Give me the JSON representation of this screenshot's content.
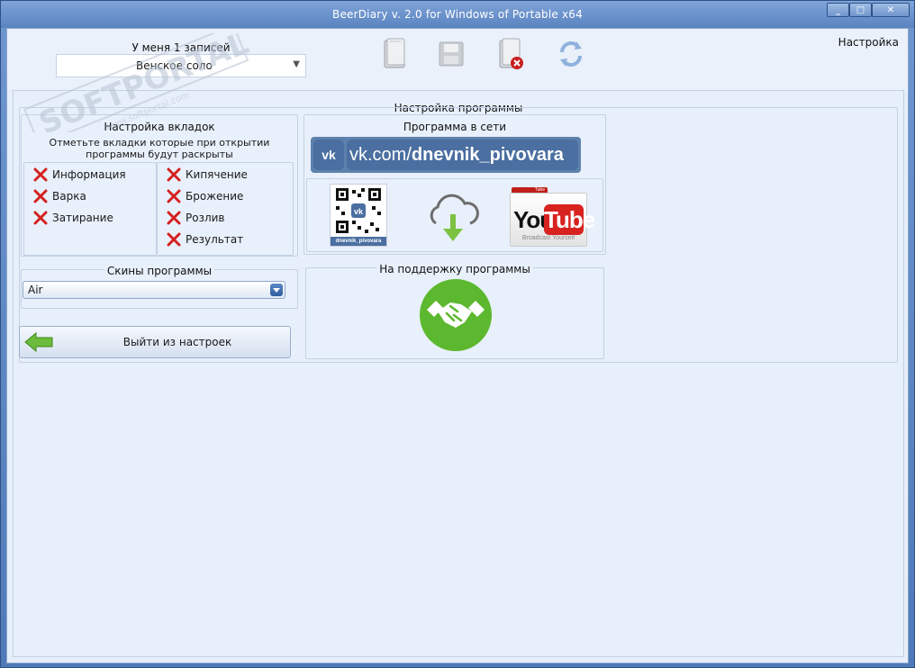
{
  "window": {
    "title": "BeerDiary v. 2.0  for Windows of Portable x64",
    "controls": {
      "minimize": "_",
      "maximize": "□",
      "close": "✕"
    }
  },
  "toolbar": {
    "records_label": "У меня 1 записей",
    "records_selected": "Венское соло",
    "settings_link": "Настройка",
    "icons": [
      "new-record-icon",
      "save-icon",
      "delete-record-icon",
      "refresh-icon"
    ]
  },
  "main": {
    "title": "Настройка программы",
    "tabs_group": {
      "title": "Настройка вкладок",
      "hint_line1": "Отметьте вкладки которые при открытии",
      "hint_line2": "программы будут раскрыты",
      "left_items": [
        "Информация",
        "Варка",
        "Затирание"
      ],
      "right_items": [
        "Кипячение",
        "Брожение",
        "Розлив",
        "Результат"
      ],
      "checked": false
    },
    "skins_group": {
      "title": "Скины программы",
      "selected": "Air"
    },
    "exit_button": "Выйти из настроек",
    "online_group": {
      "title": "Программа в сети",
      "vk_logo": "vk",
      "vk_prefix": "vk.com/",
      "vk_handle": "dnevnik_pivovara",
      "qr_caption": "dnevnik_pivovara",
      "youtube_you": "You",
      "youtube_tube": "Tube",
      "youtube_tagline": "Broadcast Yourself",
      "youtube_tab": "Tube"
    },
    "support_group": {
      "title": "На поддержку программы"
    }
  },
  "watermark": {
    "brand": "SOFTPORTAL",
    "url": "www.softportal.com"
  },
  "colors": {
    "accent_green": "#5cb82e",
    "vk_blue": "#4a6fa0",
    "youtube_red": "#d8221f",
    "cross_red": "#d42020",
    "panel_bg": "#e7effa"
  }
}
